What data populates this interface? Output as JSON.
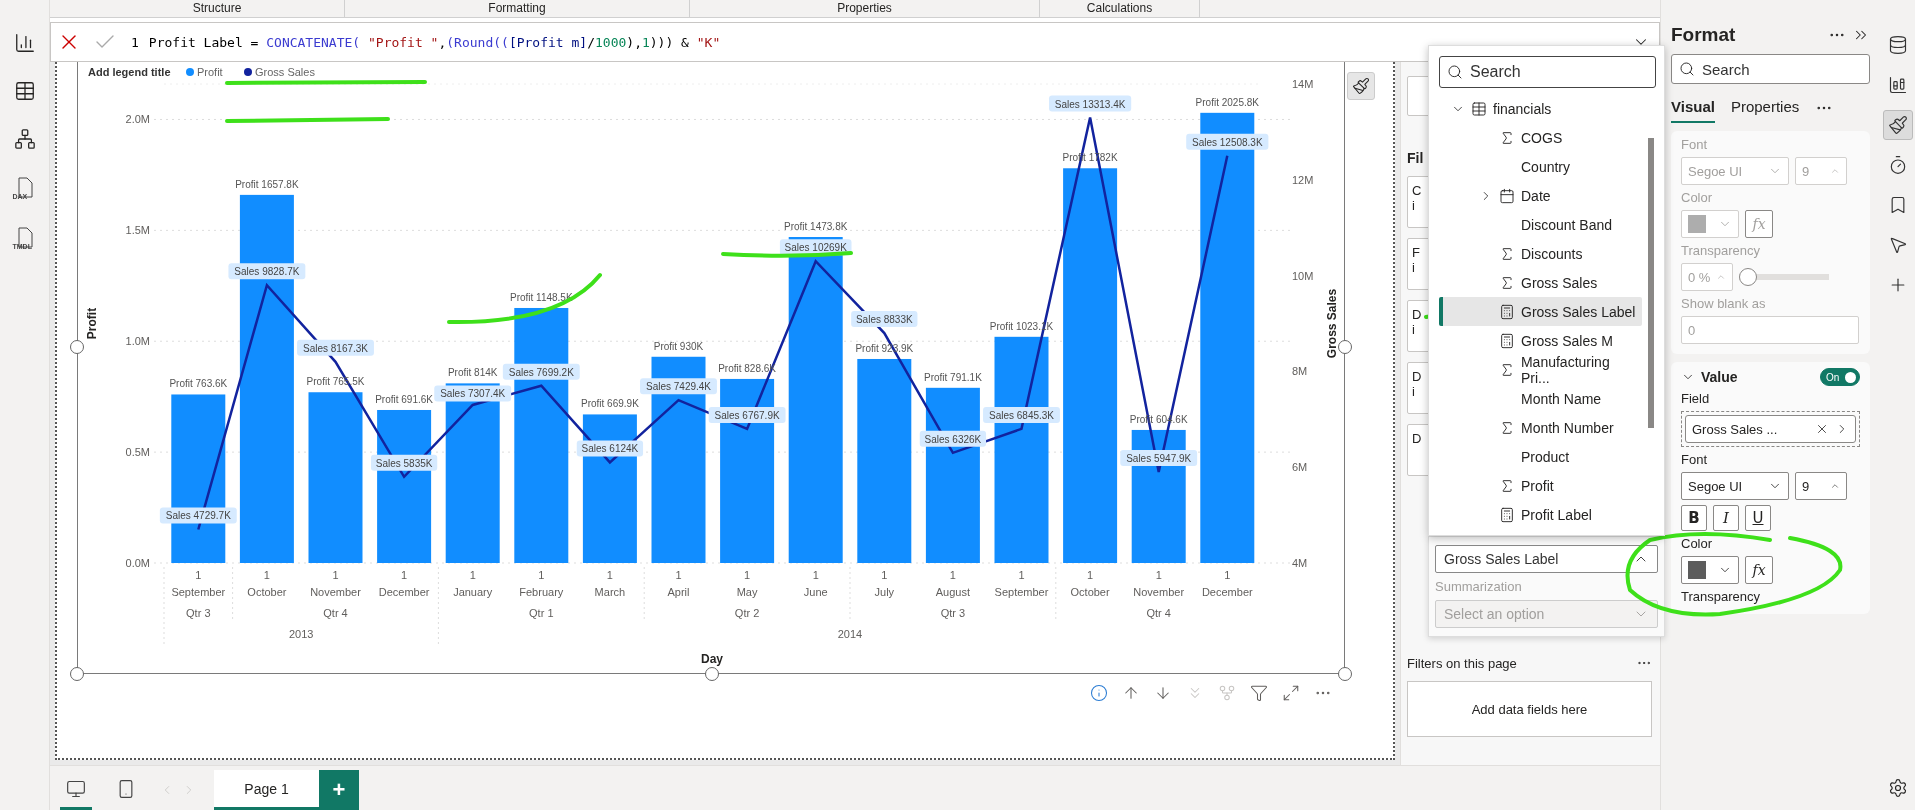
{
  "ribbon_tabs": [
    "Structure",
    "Formatting",
    "Properties",
    "Calculations"
  ],
  "left_rail": [
    {
      "kind": "report"
    },
    {
      "kind": "table"
    },
    {
      "kind": "model"
    },
    {
      "kind": "dax",
      "label": "DAX"
    },
    {
      "kind": "tmdl",
      "label": "TMDL"
    }
  ],
  "formula_bar": {
    "line": "1",
    "tokens": [
      {
        "text": "Profit Label = ",
        "kind": "plain"
      },
      {
        "text": "CONCATENATE( ",
        "kind": "function"
      },
      {
        "text": "\"Profit \"",
        "kind": "string"
      },
      {
        "text": ",",
        "kind": "plain"
      },
      {
        "text": "(Round((",
        "kind": "function"
      },
      {
        "text": "[Profit m]",
        "kind": "column"
      },
      {
        "text": "/",
        "kind": "plain"
      },
      {
        "text": "1000",
        "kind": "number"
      },
      {
        "text": "),",
        "kind": "plain"
      },
      {
        "text": "1",
        "kind": "number"
      },
      {
        "text": "))) & ",
        "kind": "plain"
      },
      {
        "text": "\"K\"",
        "kind": "string"
      }
    ]
  },
  "chart": {
    "legend_title": "Add legend title",
    "x_levels": {
      "years": [
        {
          "label": "2013",
          "quarters": [
            {
              "label": "Qtr 3",
              "days": [
                "1"
              ]
            },
            {
              "label": "Qtr 4",
              "days": [
                "1",
                "1",
                "1"
              ]
            }
          ]
        },
        {
          "label": "2014",
          "quarters": [
            {
              "label": "Qtr 1",
              "days": [
                "1",
                "1",
                "1"
              ]
            },
            {
              "label": "Qtr 2",
              "days": [
                "1",
                "1",
                "1"
              ]
            },
            {
              "label": "Qtr 3",
              "days": [
                "1",
                "1",
                "1"
              ]
            },
            {
              "label": "Qtr 4",
              "days": [
                "1",
                "1",
                "1"
              ]
            }
          ]
        }
      ]
    },
    "bars": {
      "chart_data": {
        "type": "bar",
        "xlabel": "Day",
        "ylabel": "Profit",
        "grid": true,
        "ylim": [
          0,
          2.16
        ],
        "categories": [
          "September",
          "October",
          "November",
          "December",
          "January",
          "February",
          "March",
          "April",
          "May",
          "June",
          "July",
          "August",
          "September",
          "October",
          "November",
          "December"
        ],
        "yticks": [
          {
            "value": 0,
            "label": "0.0M"
          },
          {
            "value": 0.5,
            "label": "0.5M"
          },
          {
            "value": 1,
            "label": "1.0M"
          },
          {
            "value": 1.5,
            "label": "1.5M"
          },
          {
            "value": 2,
            "label": "2.0M"
          }
        ],
        "series": [
          {
            "name": "Profit",
            "color": "#118dff",
            "values": [
              0.76,
              1.66,
              0.77,
              0.69,
              0.81,
              1.15,
              0.67,
              0.93,
              0.83,
              1.47,
              0.92,
              0.79,
              1.02,
              1.78,
              0.6,
              2.03
            ]
          }
        ],
        "value_labels": [
          "Profit 763.6K",
          "Profit 1657.8K",
          "Profit 765.5K",
          "Profit 691.6K",
          "Profit 814K",
          "Profit 1148.5K",
          "Profit 669.9K",
          "Profit 930K",
          "Profit 828.6K",
          "Profit 1473.8K",
          "Profit 923.9K",
          "Profit 791.1K",
          "Profit 1023.1K",
          "Profit 1782K",
          "Profit 604.6K",
          "Profit 2025.8K"
        ]
      }
    },
    "line": {
      "chart_data": {
        "type": "line",
        "ylabel": "Gross Sales",
        "ylim": [
          4,
          14
        ],
        "yticks": [
          {
            "value": 4,
            "label": "4M"
          },
          {
            "value": 6,
            "label": "6M"
          },
          {
            "value": 8,
            "label": "8M"
          },
          {
            "value": 10,
            "label": "10M"
          },
          {
            "value": 12,
            "label": "12M"
          },
          {
            "value": 14,
            "label": "14M"
          }
        ],
        "series": [
          {
            "name": "Gross Sales",
            "color": "#12239e",
            "values": [
              4.7,
              9.8,
              8.2,
              5.8,
              7.3,
              7.7,
              6.1,
              7.4,
              6.8,
              10.3,
              8.8,
              6.3,
              6.8,
              13.3,
              5.9,
              12.5
            ]
          }
        ],
        "value_labels": [
          "Sales 4729.7K",
          "Sales 9828.7K",
          "Sales 8167.3K",
          "Sales 5835K",
          "Sales 7307.4K",
          "Sales 7699.2K",
          "Sales 6124K",
          "Sales 7429.4K",
          "Sales 6767.9K",
          "Sales 10269K",
          "Sales 8833K",
          "Sales 6326K",
          "Sales 6845.3K",
          "Sales 13313.4K",
          "Sales 5947.9K",
          "Sales 12508.3K"
        ]
      }
    }
  },
  "visual_toolbar": [
    {
      "kind": "info",
      "disabled": false
    },
    {
      "kind": "up",
      "disabled": false
    },
    {
      "kind": "down",
      "disabled": false
    },
    {
      "kind": "expand",
      "disabled": true
    },
    {
      "kind": "drill",
      "disabled": true
    },
    {
      "kind": "filter",
      "disabled": false
    },
    {
      "kind": "focus",
      "disabled": false
    },
    {
      "kind": "more",
      "disabled": false
    }
  ],
  "filters_pane": {
    "title": "Fil",
    "cards": [
      {
        "lines": [
          "C",
          "i"
        ]
      },
      {
        "lines": [
          "F",
          "i"
        ]
      },
      {
        "lines": [
          "D",
          "i"
        ]
      },
      {
        "lines": [
          "D",
          "i"
        ]
      },
      {
        "lines": [
          "D"
        ]
      }
    ],
    "page_section": "Filters on this page",
    "drop_zone": "Add data fields here"
  },
  "field_picker": {
    "search": {
      "placeholder": "Search"
    },
    "tree": [
      {
        "label": "financials",
        "kind": "table",
        "expanded": true,
        "selected": false,
        "children": [
          {
            "label": "COGS",
            "kind": "measure",
            "selected": false
          },
          {
            "label": "Country",
            "kind": "text",
            "selected": false
          },
          {
            "label": "Date",
            "kind": "date",
            "expanded": false,
            "selected": false
          },
          {
            "label": "Discount Band",
            "kind": "text",
            "selected": false
          },
          {
            "label": "Discounts",
            "kind": "measure",
            "selected": false
          },
          {
            "label": "Gross Sales",
            "kind": "measure",
            "selected": false
          },
          {
            "label": "Gross Sales Label",
            "kind": "calculated",
            "selected": true
          },
          {
            "label": "Gross Sales M",
            "kind": "calculated",
            "selected": false
          },
          {
            "label": "Manufacturing Pri...",
            "kind": "measure",
            "selected": false
          },
          {
            "label": "Month Name",
            "kind": "text",
            "selected": false
          },
          {
            "label": "Month Number",
            "kind": "measure",
            "selected": false
          },
          {
            "label": "Product",
            "kind": "text",
            "selected": false
          },
          {
            "label": "Profit",
            "kind": "measure",
            "selected": false
          },
          {
            "label": "Profit Label",
            "kind": "calculated",
            "selected": false
          }
        ]
      }
    ],
    "value": "Gross Sales Label",
    "summarization_label": "Summarization",
    "summarization": {
      "placeholder": "Select an option",
      "disabled": true
    }
  },
  "format_pane": {
    "title": "Format",
    "search": {
      "placeholder": "Search"
    },
    "tabs": [
      {
        "label": "Visual",
        "selected": true
      },
      {
        "label": "Properties",
        "selected": false
      }
    ],
    "sections": [
      {
        "kind": "options",
        "disabled": true,
        "font_label": "Font",
        "font": "Segoe UI",
        "size": "9",
        "color_label": "Color",
        "fx": "fx",
        "transparency_label": "Transparency",
        "transparency": "0 %",
        "level": 0,
        "blank_label": "Show blank as",
        "blank": "0"
      },
      {
        "kind": "value",
        "disabled": false,
        "title": "Value",
        "expanded": true,
        "on": true,
        "toggle_label": "On",
        "field_label": "Field",
        "field": "Gross Sales ...",
        "font_label": "Font",
        "font": "Segoe UI",
        "size": "9",
        "styles": [
          {
            "label": "B",
            "kind": "bold"
          },
          {
            "label": "I",
            "kind": "italic"
          },
          {
            "label": "U",
            "kind": "underline"
          }
        ],
        "color_label": "Color",
        "fx": "fx",
        "transparency_label": "Transparency"
      }
    ]
  },
  "right_rail": [
    {
      "kind": "data",
      "selected": false
    },
    {
      "kind": "build",
      "selected": false
    },
    {
      "kind": "format",
      "selected": true
    },
    {
      "kind": "performance",
      "selected": false
    },
    {
      "kind": "bookmark",
      "selected": false
    },
    {
      "kind": "selection",
      "selected": false
    },
    {
      "kind": "add",
      "selected": false
    }
  ],
  "page_bar": {
    "views": [
      {
        "kind": "desktop",
        "selected": true
      },
      {
        "kind": "mobile",
        "selected": false
      }
    ],
    "pages": [
      {
        "label": "Page 1",
        "selected": true
      }
    ],
    "add_label": "+"
  }
}
